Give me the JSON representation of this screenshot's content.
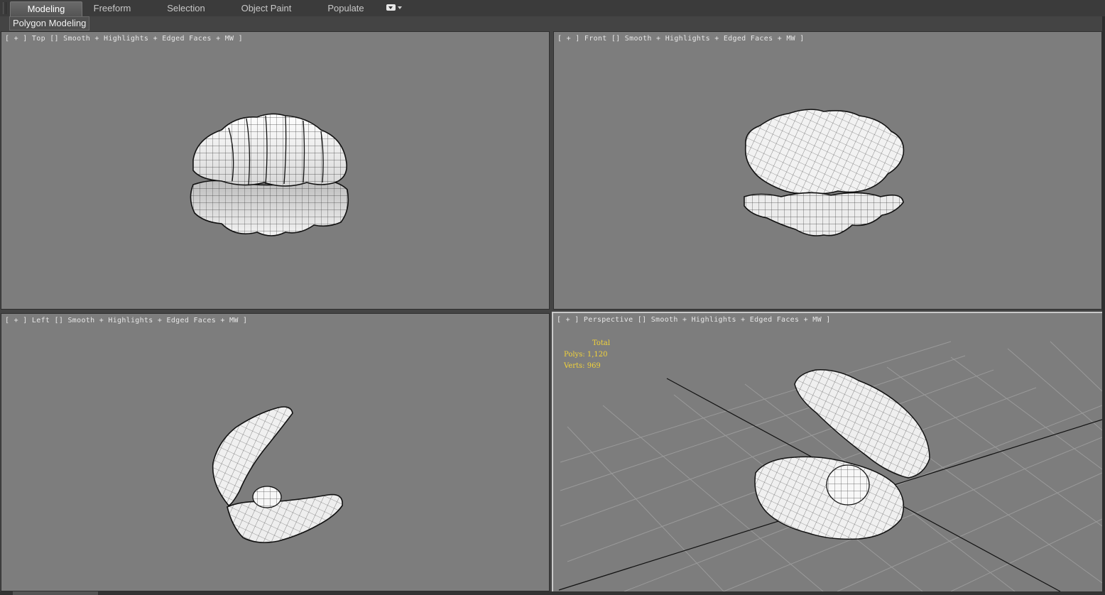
{
  "ribbon": {
    "tabs": [
      {
        "label": "Modeling",
        "active": true
      },
      {
        "label": "Freeform",
        "active": false
      },
      {
        "label": "Selection",
        "active": false
      },
      {
        "label": "Object Paint",
        "active": false
      },
      {
        "label": "Populate",
        "active": false
      }
    ],
    "panel_label": "Polygon Modeling"
  },
  "viewports": {
    "top": {
      "label": "[ + ] Top [] Smooth + Highlights + Edged Faces + MW ]"
    },
    "front": {
      "label": "[ + ] Front [] Smooth + Highlights + Edged Faces + MW ]"
    },
    "left": {
      "label": "[ + ] Left [] Smooth + Highlights + Edged Faces + MW ]"
    },
    "perspective": {
      "label": "[ + ] Perspective [] Smooth + Highlights + Edged Faces + MW ]",
      "stats": {
        "title": "Total",
        "polys": "Polys: 1,120",
        "verts": "Verts: 969"
      }
    }
  },
  "colors": {
    "viewport_bg": "#7d7d7d",
    "stats_text": "#f2d33a",
    "ui_bg": "#444444"
  }
}
